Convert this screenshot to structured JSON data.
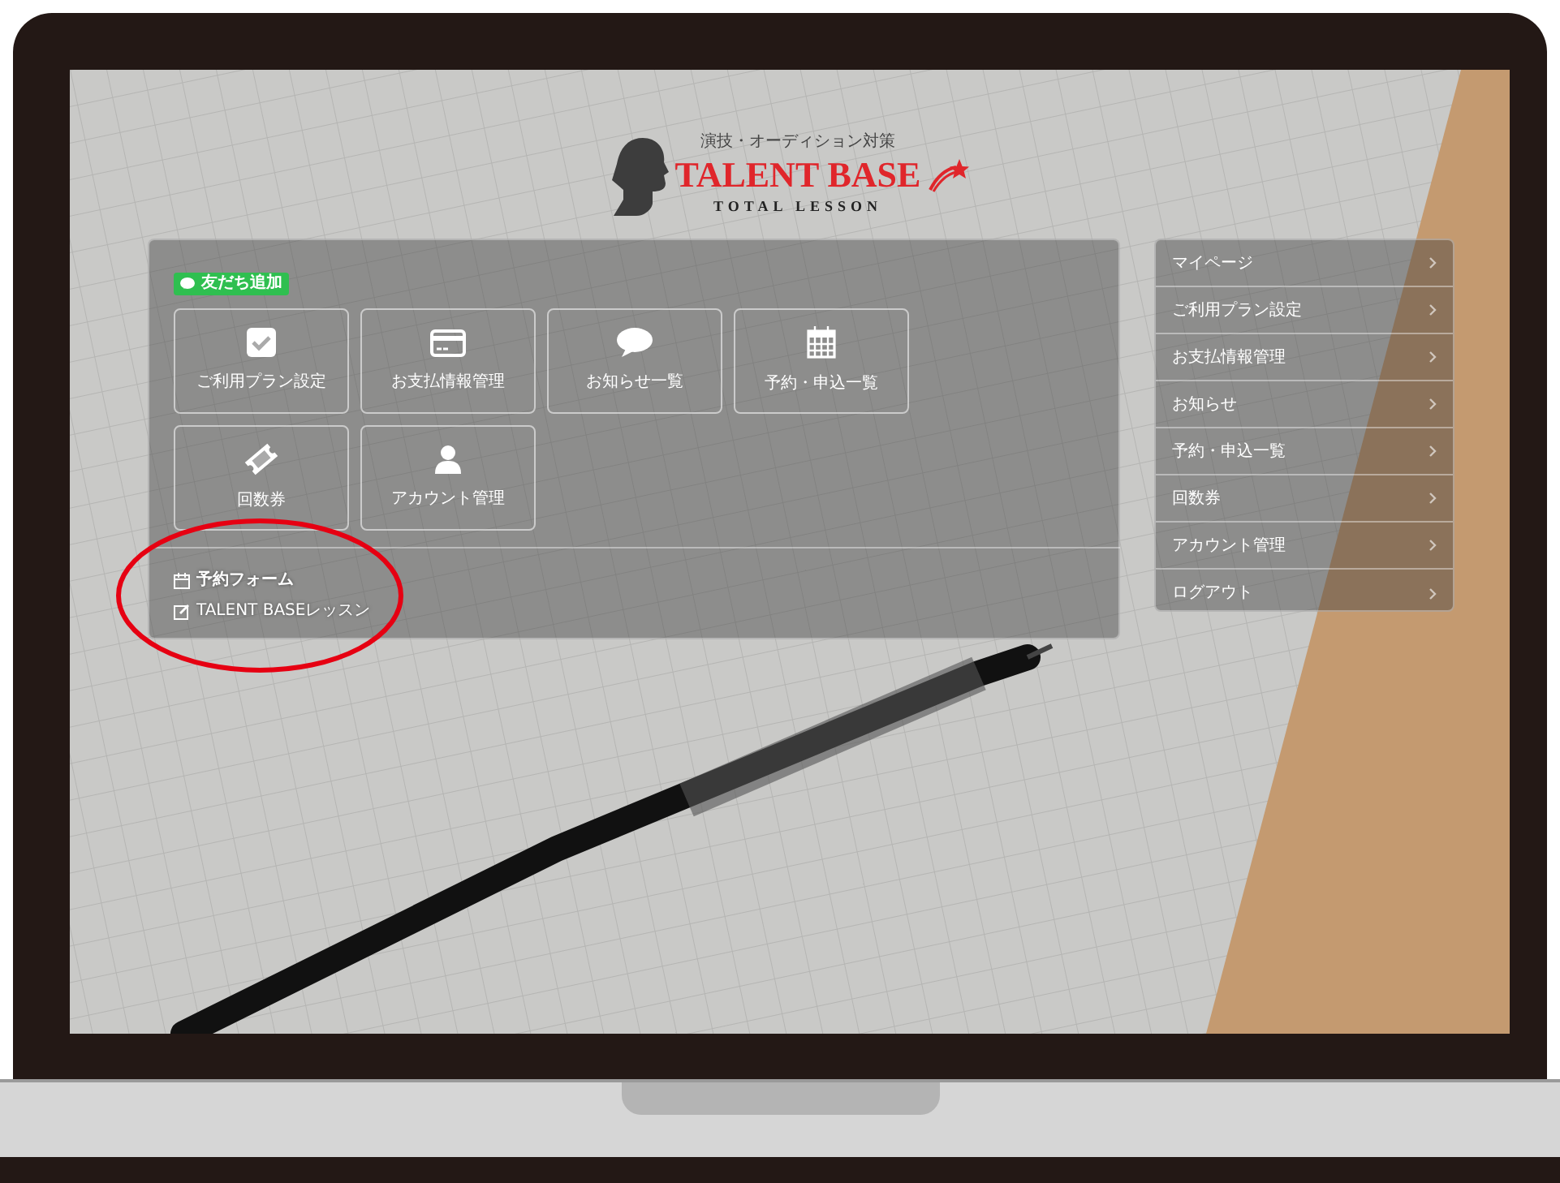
{
  "logo": {
    "tagline": "演技・オーディション対策",
    "name": "TALENT BASE",
    "subtitle": "TOTAL LESSON"
  },
  "line_button": {
    "label": "友だち追加"
  },
  "tiles": [
    {
      "label": "ご利用プラン設定",
      "kind": "check"
    },
    {
      "label": "お支払情報管理",
      "kind": "card"
    },
    {
      "label": "お知らせ一覧",
      "kind": "chat"
    },
    {
      "label": "予約・申込一覧",
      "kind": "calendar"
    },
    {
      "label": "回数券",
      "kind": "ticket"
    },
    {
      "label": "アカウント管理",
      "kind": "user"
    }
  ],
  "booking_form": {
    "heading": "予約フォーム",
    "links": [
      "TALENT BASEレッスン"
    ]
  },
  "side_menu": {
    "items": [
      "マイページ",
      "ご利用プラン設定",
      "お支払情報管理",
      "お知らせ",
      "予約・申込一覧",
      "回数券",
      "アカウント管理",
      "ログアウト"
    ]
  }
}
